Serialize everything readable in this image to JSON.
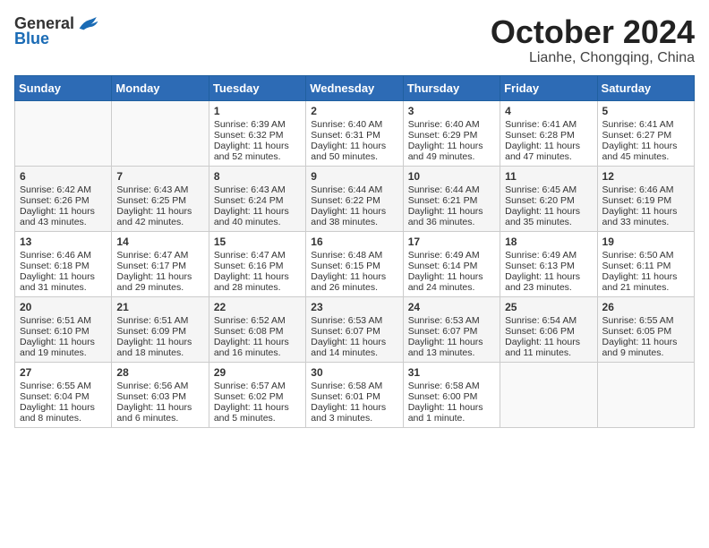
{
  "header": {
    "logo_general": "General",
    "logo_blue": "Blue",
    "month_title": "October 2024",
    "location": "Lianhe, Chongqing, China"
  },
  "days_of_week": [
    "Sunday",
    "Monday",
    "Tuesday",
    "Wednesday",
    "Thursday",
    "Friday",
    "Saturday"
  ],
  "weeks": [
    {
      "days": [
        {
          "num": "",
          "info": ""
        },
        {
          "num": "",
          "info": ""
        },
        {
          "num": "1",
          "sunrise": "Sunrise: 6:39 AM",
          "sunset": "Sunset: 6:32 PM",
          "daylight": "Daylight: 11 hours and 52 minutes."
        },
        {
          "num": "2",
          "sunrise": "Sunrise: 6:40 AM",
          "sunset": "Sunset: 6:31 PM",
          "daylight": "Daylight: 11 hours and 50 minutes."
        },
        {
          "num": "3",
          "sunrise": "Sunrise: 6:40 AM",
          "sunset": "Sunset: 6:29 PM",
          "daylight": "Daylight: 11 hours and 49 minutes."
        },
        {
          "num": "4",
          "sunrise": "Sunrise: 6:41 AM",
          "sunset": "Sunset: 6:28 PM",
          "daylight": "Daylight: 11 hours and 47 minutes."
        },
        {
          "num": "5",
          "sunrise": "Sunrise: 6:41 AM",
          "sunset": "Sunset: 6:27 PM",
          "daylight": "Daylight: 11 hours and 45 minutes."
        }
      ]
    },
    {
      "days": [
        {
          "num": "6",
          "sunrise": "Sunrise: 6:42 AM",
          "sunset": "Sunset: 6:26 PM",
          "daylight": "Daylight: 11 hours and 43 minutes."
        },
        {
          "num": "7",
          "sunrise": "Sunrise: 6:43 AM",
          "sunset": "Sunset: 6:25 PM",
          "daylight": "Daylight: 11 hours and 42 minutes."
        },
        {
          "num": "8",
          "sunrise": "Sunrise: 6:43 AM",
          "sunset": "Sunset: 6:24 PM",
          "daylight": "Daylight: 11 hours and 40 minutes."
        },
        {
          "num": "9",
          "sunrise": "Sunrise: 6:44 AM",
          "sunset": "Sunset: 6:22 PM",
          "daylight": "Daylight: 11 hours and 38 minutes."
        },
        {
          "num": "10",
          "sunrise": "Sunrise: 6:44 AM",
          "sunset": "Sunset: 6:21 PM",
          "daylight": "Daylight: 11 hours and 36 minutes."
        },
        {
          "num": "11",
          "sunrise": "Sunrise: 6:45 AM",
          "sunset": "Sunset: 6:20 PM",
          "daylight": "Daylight: 11 hours and 35 minutes."
        },
        {
          "num": "12",
          "sunrise": "Sunrise: 6:46 AM",
          "sunset": "Sunset: 6:19 PM",
          "daylight": "Daylight: 11 hours and 33 minutes."
        }
      ]
    },
    {
      "days": [
        {
          "num": "13",
          "sunrise": "Sunrise: 6:46 AM",
          "sunset": "Sunset: 6:18 PM",
          "daylight": "Daylight: 11 hours and 31 minutes."
        },
        {
          "num": "14",
          "sunrise": "Sunrise: 6:47 AM",
          "sunset": "Sunset: 6:17 PM",
          "daylight": "Daylight: 11 hours and 29 minutes."
        },
        {
          "num": "15",
          "sunrise": "Sunrise: 6:47 AM",
          "sunset": "Sunset: 6:16 PM",
          "daylight": "Daylight: 11 hours and 28 minutes."
        },
        {
          "num": "16",
          "sunrise": "Sunrise: 6:48 AM",
          "sunset": "Sunset: 6:15 PM",
          "daylight": "Daylight: 11 hours and 26 minutes."
        },
        {
          "num": "17",
          "sunrise": "Sunrise: 6:49 AM",
          "sunset": "Sunset: 6:14 PM",
          "daylight": "Daylight: 11 hours and 24 minutes."
        },
        {
          "num": "18",
          "sunrise": "Sunrise: 6:49 AM",
          "sunset": "Sunset: 6:13 PM",
          "daylight": "Daylight: 11 hours and 23 minutes."
        },
        {
          "num": "19",
          "sunrise": "Sunrise: 6:50 AM",
          "sunset": "Sunset: 6:11 PM",
          "daylight": "Daylight: 11 hours and 21 minutes."
        }
      ]
    },
    {
      "days": [
        {
          "num": "20",
          "sunrise": "Sunrise: 6:51 AM",
          "sunset": "Sunset: 6:10 PM",
          "daylight": "Daylight: 11 hours and 19 minutes."
        },
        {
          "num": "21",
          "sunrise": "Sunrise: 6:51 AM",
          "sunset": "Sunset: 6:09 PM",
          "daylight": "Daylight: 11 hours and 18 minutes."
        },
        {
          "num": "22",
          "sunrise": "Sunrise: 6:52 AM",
          "sunset": "Sunset: 6:08 PM",
          "daylight": "Daylight: 11 hours and 16 minutes."
        },
        {
          "num": "23",
          "sunrise": "Sunrise: 6:53 AM",
          "sunset": "Sunset: 6:07 PM",
          "daylight": "Daylight: 11 hours and 14 minutes."
        },
        {
          "num": "24",
          "sunrise": "Sunrise: 6:53 AM",
          "sunset": "Sunset: 6:07 PM",
          "daylight": "Daylight: 11 hours and 13 minutes."
        },
        {
          "num": "25",
          "sunrise": "Sunrise: 6:54 AM",
          "sunset": "Sunset: 6:06 PM",
          "daylight": "Daylight: 11 hours and 11 minutes."
        },
        {
          "num": "26",
          "sunrise": "Sunrise: 6:55 AM",
          "sunset": "Sunset: 6:05 PM",
          "daylight": "Daylight: 11 hours and 9 minutes."
        }
      ]
    },
    {
      "days": [
        {
          "num": "27",
          "sunrise": "Sunrise: 6:55 AM",
          "sunset": "Sunset: 6:04 PM",
          "daylight": "Daylight: 11 hours and 8 minutes."
        },
        {
          "num": "28",
          "sunrise": "Sunrise: 6:56 AM",
          "sunset": "Sunset: 6:03 PM",
          "daylight": "Daylight: 11 hours and 6 minutes."
        },
        {
          "num": "29",
          "sunrise": "Sunrise: 6:57 AM",
          "sunset": "Sunset: 6:02 PM",
          "daylight": "Daylight: 11 hours and 5 minutes."
        },
        {
          "num": "30",
          "sunrise": "Sunrise: 6:58 AM",
          "sunset": "Sunset: 6:01 PM",
          "daylight": "Daylight: 11 hours and 3 minutes."
        },
        {
          "num": "31",
          "sunrise": "Sunrise: 6:58 AM",
          "sunset": "Sunset: 6:00 PM",
          "daylight": "Daylight: 11 hours and 1 minute."
        },
        {
          "num": "",
          "info": ""
        },
        {
          "num": "",
          "info": ""
        }
      ]
    }
  ]
}
